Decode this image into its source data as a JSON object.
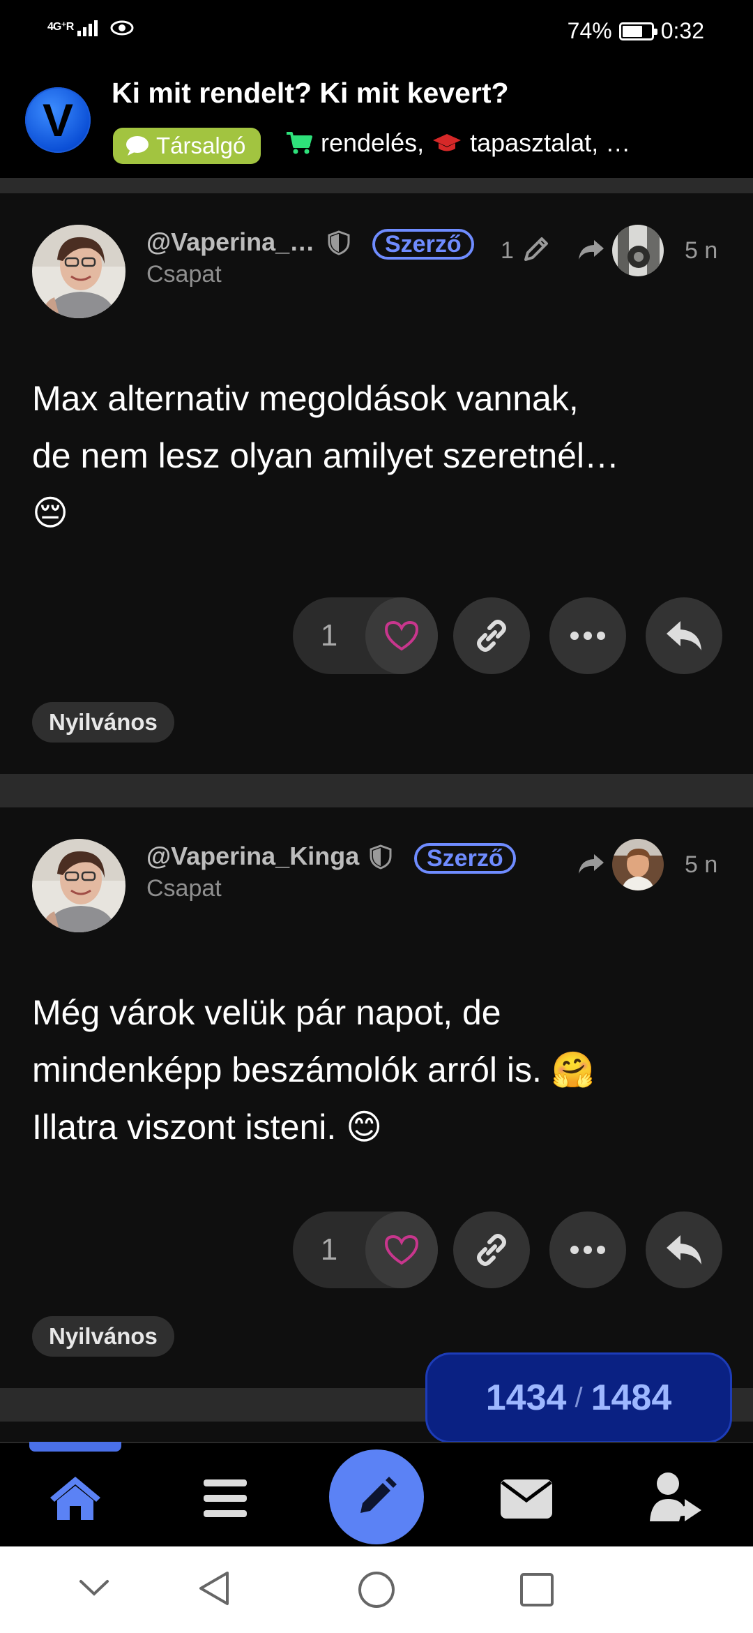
{
  "status_bar": {
    "network": "4G⁺R",
    "battery_percent": "74%",
    "battery_level": 0.74,
    "time": "0:32"
  },
  "header": {
    "logo_letter": "V",
    "title": "Ki mit rendelt? Ki mit kevert?",
    "category": "Társalgó",
    "category_color": "#a2c440",
    "tags": [
      "rendelés,",
      "tapasztalat, …"
    ]
  },
  "posts": [
    {
      "username": "@Vaperina_…",
      "group": "Csapat",
      "role_badge": "Szerző",
      "edit_count": "1",
      "time": "5 n",
      "text_lines": [
        "Max alternativ megoldások vannak,",
        "de nem lesz olyan amilyet szeretnél…"
      ],
      "emoji": "😔",
      "likes": "1",
      "visibility": "Nyilvános"
    },
    {
      "username": "@Vaperina_Kinga",
      "group": "Csapat",
      "role_badge": "Szerző",
      "time": "5 n",
      "text_lines": [
        "Még várok velük pár napot, de",
        "mindenképp beszámolók arról is. 🤗",
        "Illatra viszont isteni. 😊"
      ],
      "likes": "1",
      "visibility": "Nyilvános"
    }
  ],
  "progress": {
    "current": "1434",
    "separator": "/",
    "total": "1484"
  },
  "bottom_nav": {
    "items": [
      "home-icon",
      "menu-icon",
      "compose-icon",
      "mail-icon",
      "user-share-icon"
    ],
    "accent": "#5b82f5"
  }
}
